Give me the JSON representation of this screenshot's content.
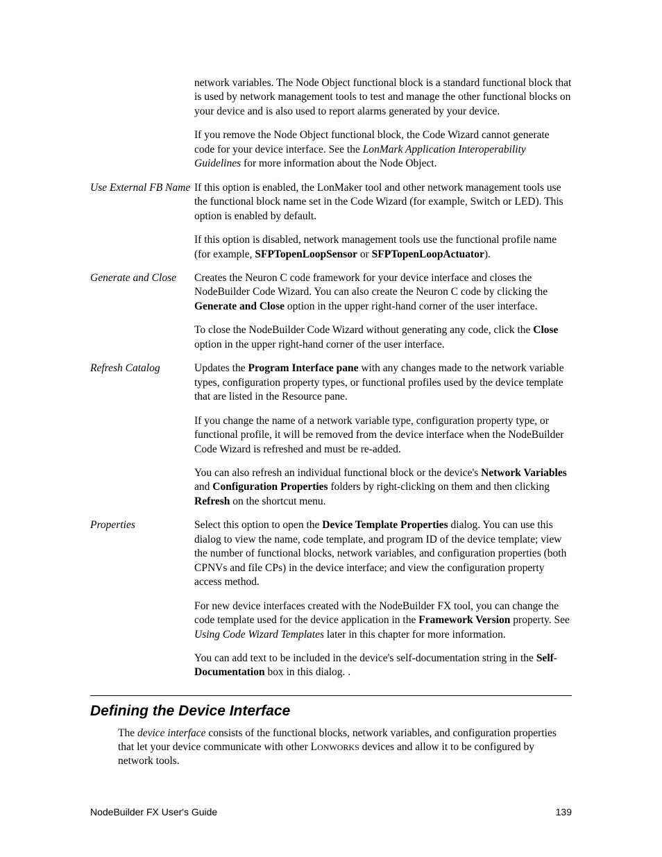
{
  "rows": {
    "intro": {
      "p1": "network variables.  The Node Object functional block is a standard functional block that is used by network management tools to test and manage the other functional blocks on your device and is also used to report alarms generated by your device.",
      "p2_a": "If you remove the Node Object functional block, the Code Wizard cannot generate code for your device interface.  See the ",
      "p2_i": "LonMark Application Interoperability Guidelines",
      "p2_b": " for more information about the Node Object."
    },
    "useExternal": {
      "term": "Use External FB Name",
      "p1": "If this option is enabled, the LonMaker tool and other network management tools use the functional block name set in the Code Wizard (for example, Switch or LED).  This option is enabled by default.",
      "p2_a": "If this option is disabled, network management tools use the functional profile name (for example, ",
      "p2_b1": "SFPTopenLoopSensor",
      "p2_mid": " or ",
      "p2_b2": "SFPTopenLoopActuator",
      "p2_end": ")."
    },
    "generate": {
      "term": "Generate and Close",
      "p1_a": "Creates the Neuron C code framework for your device interface and closes the NodeBuilder Code Wizard.  You can also create the Neuron C code by clicking the ",
      "p1_b": "Generate and Close",
      "p1_c": " option in the upper right-hand corner of the user interface.",
      "p2_a": "To close the NodeBuilder Code Wizard without generating any code, click the ",
      "p2_b": "Close",
      "p2_c": " option in the upper right-hand corner of the user interface."
    },
    "refresh": {
      "term": "Refresh Catalog",
      "p1_a": "Updates the ",
      "p1_b": "Program Interface pane",
      "p1_c": " with any changes made to the network variable types, configuration property types, or functional profiles used by the device template that are listed in the Resource pane.",
      "p2": "If you change the name of a network variable type, configuration property type, or functional profile, it will be removed from the device interface when the NodeBuilder Code Wizard is refreshed and must be re-added.",
      "p3_a": "You can also refresh an individual functional block or the device's ",
      "p3_b1": "Network Variables",
      "p3_mid": " and ",
      "p3_b2": "Configuration Properties",
      "p3_c": " folders by right-clicking on them and then clicking ",
      "p3_b3": "Refresh",
      "p3_d": " on the shortcut menu."
    },
    "properties": {
      "term": "Properties",
      "p1_a": "Select this option to open the ",
      "p1_b": "Device Template Properties",
      "p1_c": " dialog.  You can use this dialog to view the name, code template, and program ID of the device template; view the number of functional blocks, network variables, and configuration properties (both CPNVs and file CPs) in the device interface; and view the configuration property access method.",
      "p2_a": "For new device interfaces created with the NodeBuilder FX tool, you can change the code template used for the device application in the ",
      "p2_b": "Framework Version",
      "p2_mid": " property.  See ",
      "p2_i": "Using Code Wizard Templates",
      "p2_c": " later in this chapter for more information.",
      "p3_a": "You can add text to be included in the device's self-documentation string in the ",
      "p3_b": "Self-Documentation",
      "p3_c": " box in this dialog.  ."
    }
  },
  "section": {
    "heading": "Defining the Device Interface",
    "intro_a": "The ",
    "intro_i": "device interface",
    "intro_b": " consists of the functional blocks, network variables, and configuration properties that let your device communicate with other L",
    "intro_sc": "ONWORKS",
    "intro_c": " devices and allow it to be configured by network tools."
  },
  "footer": {
    "left": "NodeBuilder FX User's Guide",
    "right": "139"
  }
}
